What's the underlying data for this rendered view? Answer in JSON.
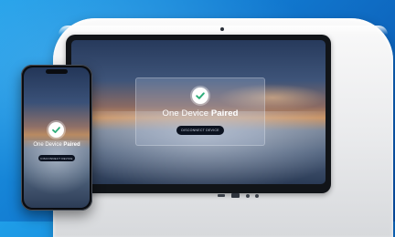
{
  "tv": {
    "title_prefix": "One Device ",
    "title_bold": "Paired",
    "button_label": "DISCONNECT DEVICE"
  },
  "phone": {
    "title_prefix": "One Device ",
    "title_bold": "Paired",
    "button_label": "DISCONNECT DEVICE"
  },
  "icons": {
    "check": "check-circle-icon",
    "camera": "camera-dot",
    "ports": [
      "headphone-jack-icon",
      "usb-port-icon",
      "indicator-dot",
      "indicator-dot"
    ]
  },
  "colors": {
    "background": "#1178cf",
    "check_green": "#2fae7b",
    "button_bg": "#0b1220",
    "shell": "#e9eaec"
  }
}
